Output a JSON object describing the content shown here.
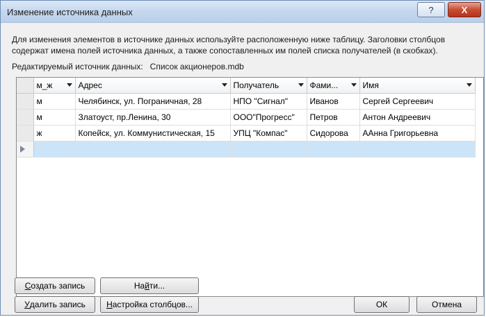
{
  "window": {
    "title": "Изменение источника данных",
    "help_label": "?",
    "close_label": "X"
  },
  "description": "Для изменения элементов в источнике данных используйте расположенную ниже таблицу. Заголовки столбцов содержат имена полей источника данных, а также сопоставленных им полей списка получателей (в скобках).",
  "editing": {
    "label": "Редактируемый источник данных:",
    "value": "Список акционеров.mdb"
  },
  "grid": {
    "columns": [
      "м_ж",
      "Адрес",
      "Получатель",
      "Фами...",
      "Имя"
    ],
    "rows": [
      [
        "м",
        "Челябинск, ул. Пограничная, 28",
        "НПО \"Сигнал\"",
        "Иванов",
        "Сергей Сергеевич"
      ],
      [
        "м",
        "Златоуст, пр.Ленина, 30",
        "ООО\"Прогресс\"",
        "Петров",
        "Антон Андреевич"
      ],
      [
        "ж",
        "Копейск, ул. Коммунистическая, 15",
        "УПЦ \"Компас\"",
        "Сидорова",
        "ААнна Григорьевна"
      ]
    ]
  },
  "buttons": {
    "create_prefix": "С",
    "create_rest": "оздать запись",
    "find_prefix": "На",
    "find_ul": "й",
    "find_rest": "ти...",
    "delete_prefix": "У",
    "delete_rest": "далить запись",
    "columns_prefix": "Н",
    "columns_rest": "астройка столбцов...",
    "ok": "ОК",
    "cancel": "Отмена"
  }
}
